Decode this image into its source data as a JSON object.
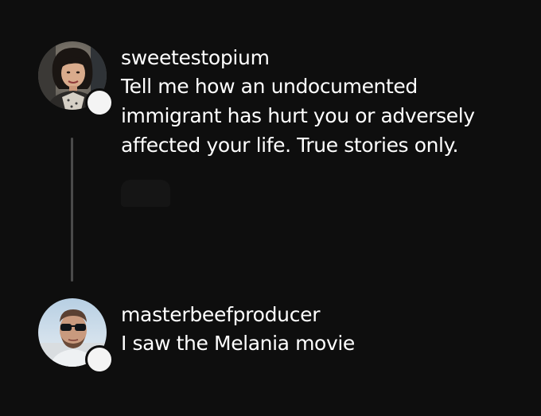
{
  "thread": {
    "posts": [
      {
        "username": "sweetestopium",
        "text_lines": [
          "Tell me how an undocumented",
          "immigrant has hurt you or adversely",
          "affected your life. True stories only."
        ],
        "avatar_icon": "profile-photo-woman"
      },
      {
        "username": "masterbeefproducer",
        "text_lines": [
          "I saw the Melania movie"
        ],
        "avatar_icon": "profile-photo-man-sunglasses"
      }
    ]
  },
  "colors": {
    "background": "#0e0e0e",
    "text": "#ffffff",
    "thread_line": "#4a4a4a",
    "badge": "#f4f4f4"
  }
}
